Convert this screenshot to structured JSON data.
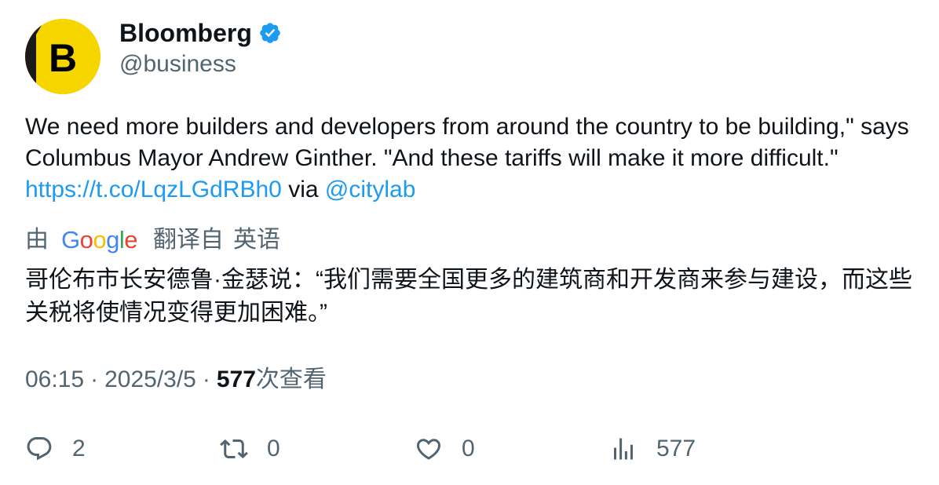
{
  "author": {
    "display_name": "Bloomberg",
    "handle": "@business",
    "avatar_letter": "B",
    "verified": true,
    "avatar_color": "#f7d600",
    "verified_color": "#1d9bf0"
  },
  "tweet": {
    "text_main": "We need more builders and developers from around the country to be building,\" says Columbus Mayor Andrew Ginther. \"And these tariffs will make it more difficult.\" ",
    "link": "https://t.co/LqzLGdRBh0",
    "via_label": " via ",
    "mention": "@citylab"
  },
  "translation": {
    "by_label": "由",
    "provider": "Google",
    "from_label": "翻译自",
    "language": "英语",
    "text": "哥伦布市长安德鲁·金瑟说：“我们需要全国更多的建筑商和开发商来参与建设，而这些关税将使情况变得更加困难。”"
  },
  "meta": {
    "time": "06:15",
    "separator": "·",
    "date": "2025/3/5",
    "views_count": "577",
    "views_label": "次查看"
  },
  "actions": {
    "replies": "2",
    "retweets": "0",
    "likes": "0",
    "views": "577"
  },
  "icons": {
    "reply": "reply-icon",
    "retweet": "retweet-icon",
    "like": "heart-icon",
    "views": "bar-chart-icon",
    "verified": "verified-badge-icon"
  },
  "colors": {
    "link": "#1d9bf0",
    "secondary_text": "#536471",
    "primary_text": "#0f1419"
  }
}
